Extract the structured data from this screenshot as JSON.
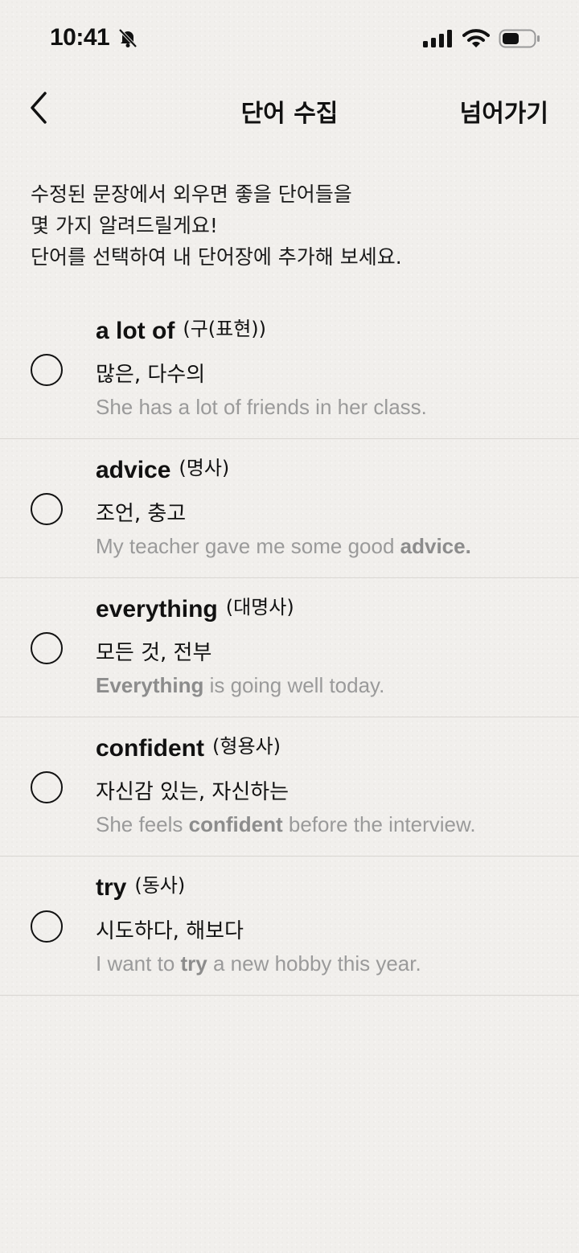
{
  "status_bar": {
    "time": "10:41",
    "icons": [
      "bell-slash-icon",
      "signal-icon",
      "wifi-icon",
      "battery-icon"
    ]
  },
  "nav": {
    "title": "단어 수집",
    "skip_label": "넘어가기",
    "back_icon": "chevron-left-icon"
  },
  "intro": {
    "lines": [
      "수정된 문장에서 외우면 좋을 단어들을",
      "몇 가지 알려드릴게요!",
      "단어를 선택하여 내 단어장에 추가해 보세요."
    ]
  },
  "words": [
    {
      "word": "a lot of",
      "pos": "(구(표현))",
      "meaning": "많은, 다수의",
      "example": {
        "before": "She has a lot of friends in her class.",
        "highlight": "",
        "after": ""
      }
    },
    {
      "word": "advice",
      "pos": "(명사)",
      "meaning": "조언, 충고",
      "example": {
        "before": "My teacher gave me some good ",
        "highlight": "advice.",
        "after": ""
      }
    },
    {
      "word": "everything",
      "pos": "(대명사)",
      "meaning": "모든 것, 전부",
      "example": {
        "before": "",
        "highlight": "Everything",
        "after": " is going well today."
      }
    },
    {
      "word": "confident",
      "pos": "(형용사)",
      "meaning": "자신감 있는, 자신하는",
      "example": {
        "before": "She feels ",
        "highlight": "confident",
        "after": " before the interview."
      }
    },
    {
      "word": "try",
      "pos": "(동사)",
      "meaning": "시도하다, 해보다",
      "example": {
        "before": "I want to ",
        "highlight": "try",
        "after": " a new hobby this year."
      }
    }
  ],
  "colors": {
    "background": "#f1efec",
    "text": "#111111",
    "example_text": "#9a9a9a",
    "divider": "#d9d6d2"
  }
}
